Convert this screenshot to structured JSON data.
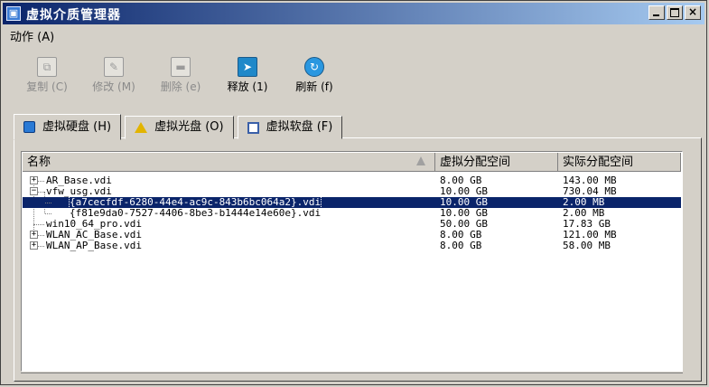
{
  "window": {
    "title": "虚拟介质管理器",
    "close_glyph": "×"
  },
  "menu": {
    "actions": "动作 (A)"
  },
  "toolbar": {
    "copy": "复制 (C)",
    "modify": "修改 (M)",
    "delete": "删除 (e)",
    "release": "释放 (1)",
    "refresh": "刷新 (f)"
  },
  "tabs": {
    "hard_disk": "虚拟硬盘 (H)",
    "optical": "虚拟光盘 (O)",
    "floppy": "虚拟软盘 (F)"
  },
  "columns": {
    "name": "名称",
    "virtual": "虚拟分配空间",
    "actual": "实际分配空间"
  },
  "rows": [
    {
      "name": "AR_Base.vdi",
      "virtual": "8.00 GB",
      "actual": "143.00 MB",
      "toggle": "+"
    },
    {
      "name": "vfw_usg.vdi",
      "virtual": "10.00 GB",
      "actual": "730.04 MB",
      "toggle": "−"
    },
    {
      "name": "{a7cecfdf-6280-44e4-ac9c-843b6bc064a2}.vdi",
      "virtual": "10.00 GB",
      "actual": "2.00 MB"
    },
    {
      "name": "{f81e9da0-7527-4406-8be3-b1444e14e60e}.vdi",
      "virtual": "10.00 GB",
      "actual": "2.00 MB"
    },
    {
      "name": "win10_64_pro.vdi",
      "virtual": "50.00 GB",
      "actual": "17.83 GB"
    },
    {
      "name": "WLAN_AC_Base.vdi",
      "virtual": "8.00 GB",
      "actual": "121.00 MB",
      "toggle": "+"
    },
    {
      "name": "WLAN_AP_Base.vdi",
      "virtual": "8.00 GB",
      "actual": "58.00 MB",
      "toggle": "+"
    }
  ],
  "colors": {
    "selection": "#0a246a",
    "face": "#d4d0c8"
  }
}
